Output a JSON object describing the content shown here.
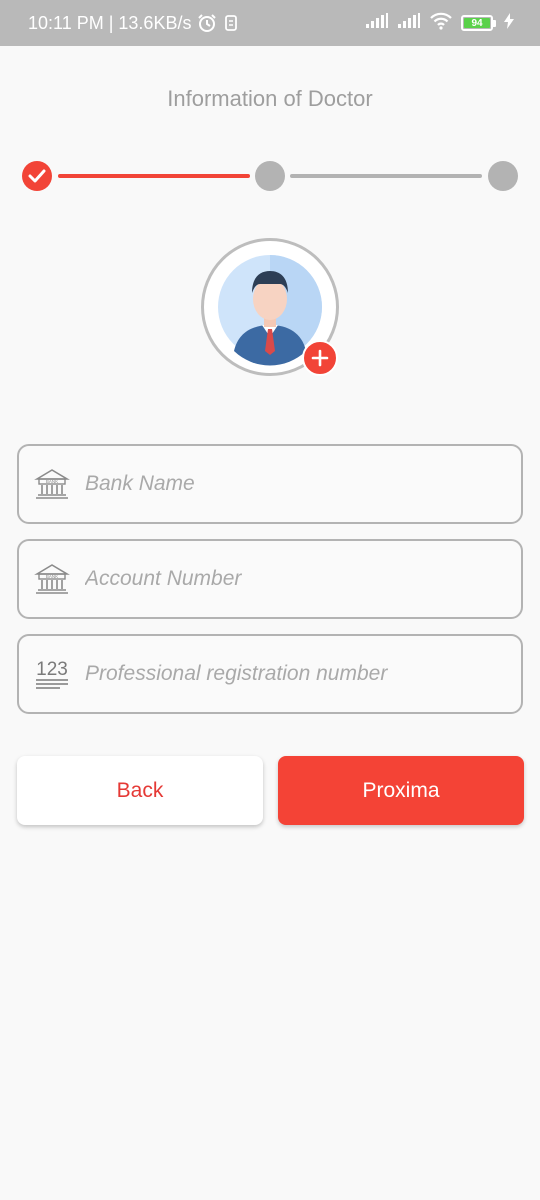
{
  "status_bar": {
    "time": "10:11 PM",
    "separator": "|",
    "speed": "13.6KB/s",
    "battery_level": "94",
    "icons": [
      "alarm-icon",
      "sim-icon",
      "signal-icon",
      "signal-icon",
      "wifi-icon",
      "battery-icon",
      "charging-icon"
    ]
  },
  "header": {
    "title": "Information of Doctor"
  },
  "stepper": {
    "total_steps": 3,
    "current_step": 1,
    "completed_steps": [
      1
    ]
  },
  "avatar": {
    "icon": "doctor-avatar-icon",
    "add_icon": "plus-icon"
  },
  "form": {
    "bank_name": {
      "placeholder": "Bank Name",
      "value": "",
      "icon": "bank-icon"
    },
    "account_number": {
      "placeholder": "Account Number",
      "value": "",
      "icon": "bank-icon"
    },
    "registration_number": {
      "placeholder": "Professional registration number",
      "value": "",
      "icon": "numbers-icon"
    }
  },
  "buttons": {
    "back_label": "Back",
    "next_label": "Proxima"
  },
  "colors": {
    "accent": "#f44336",
    "inactive": "#b3b3b3",
    "status_bar": "#b9b9b9"
  }
}
